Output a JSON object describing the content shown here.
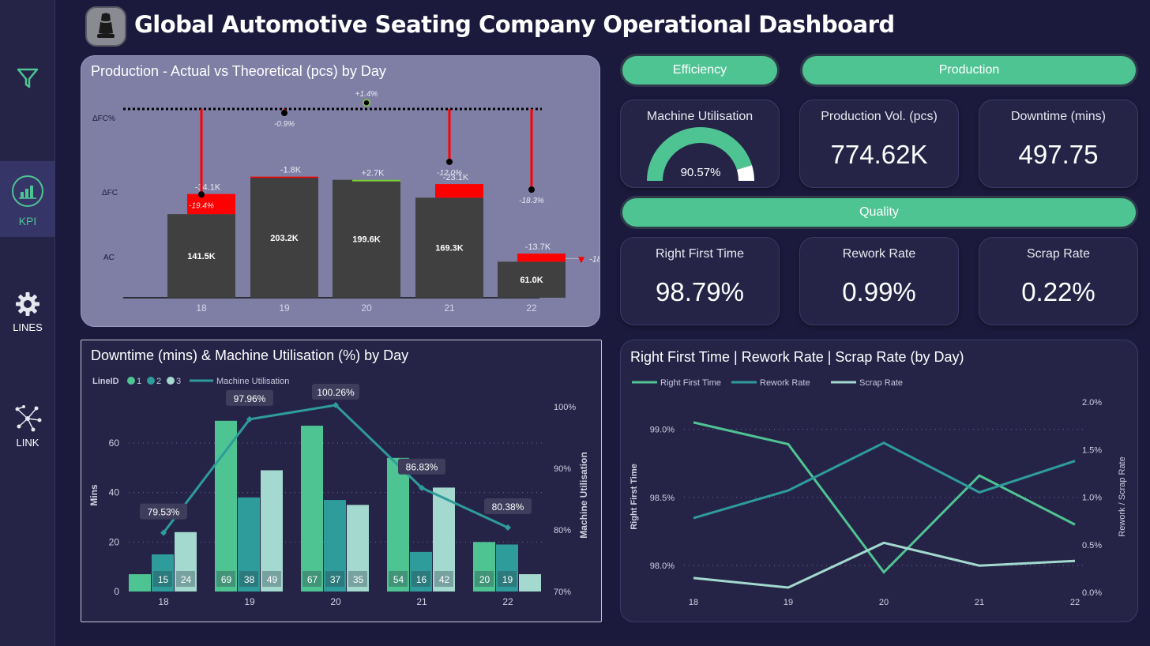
{
  "app": {
    "title": "Global Automotive Seating Company Operational Dashboard"
  },
  "sidebar": {
    "items": [
      {
        "label": "",
        "icon": "filter-icon"
      },
      {
        "label": "KPI",
        "icon": "kpi-chart-icon",
        "active": true
      },
      {
        "label": "LINES",
        "icon": "gear-icon"
      },
      {
        "label": "LINK",
        "icon": "network-link-icon"
      }
    ]
  },
  "colors": {
    "accent": "#4fc493",
    "teal": "#2e9c9a",
    "light_teal": "#a3d9cf",
    "red": "#ff0000",
    "bar_dark": "#404040",
    "panel_lavender": "#7f7fa5",
    "background": "#1c1a3c"
  },
  "sections": {
    "efficiency": "Efficiency",
    "production": "Production",
    "quality": "Quality"
  },
  "kpis": {
    "machine_utilisation": {
      "label": "Machine Utilisation",
      "value": "90.57%",
      "fraction": 0.9057
    },
    "production_vol": {
      "label": "Production Vol. (pcs)",
      "value": "774.62K"
    },
    "downtime": {
      "label": "Downtime (mins)",
      "value": "497.75"
    },
    "right_first_time": {
      "label": "Right First Time",
      "value": "98.79%"
    },
    "rework_rate": {
      "label": "Rework Rate",
      "value": "0.99%"
    },
    "scrap_rate": {
      "label": "Scrap Rate",
      "value": "0.22%"
    }
  },
  "chart_data": [
    {
      "type": "bar",
      "title": "Production - Actual vs Theoretical (pcs) by Day",
      "row_labels": [
        "ΔFC%",
        "ΔFC",
        "AC"
      ],
      "categories": [
        "18",
        "19",
        "20",
        "21",
        "22"
      ],
      "actual": [
        141.5,
        203.2,
        199.6,
        169.3,
        61.0
      ],
      "actual_labels": [
        "141.5K",
        "203.2K",
        "199.6K",
        "169.3K",
        "61.0K"
      ],
      "delta": [
        -34.1,
        -1.8,
        2.7,
        -23.1,
        -13.7
      ],
      "delta_labels": [
        "-34.1K",
        "-1.8K",
        "+2.7K",
        "-23.1K",
        "-13.7K"
      ],
      "delta_pct": [
        -19.4,
        -0.9,
        1.4,
        -12.0,
        -18.3
      ],
      "delta_pct_labels": [
        "-19.4%",
        "-0.9%",
        "+1.4%",
        "-12.0%",
        "-18.3%"
      ],
      "total_delta_label": "-18.3%"
    },
    {
      "type": "bar",
      "title": "Downtime (mins) & Machine Utilisation (%) by Day",
      "legend_title": "LineID",
      "legend": [
        "1",
        "2",
        "3",
        "Machine Utilisation"
      ],
      "categories": [
        "18",
        "19",
        "20",
        "21",
        "22"
      ],
      "series": [
        {
          "name": "1",
          "values": [
            7,
            69,
            67,
            54,
            20
          ]
        },
        {
          "name": "2",
          "values": [
            15,
            38,
            37,
            16,
            19
          ]
        },
        {
          "name": "3",
          "values": [
            24,
            49,
            35,
            42,
            7
          ]
        }
      ],
      "bar_labels": [
        [
          "",
          "15",
          "24"
        ],
        [
          "69",
          "38",
          "49"
        ],
        [
          "67",
          "37",
          "35"
        ],
        [
          "54",
          "16",
          "42"
        ],
        [
          "20",
          "19",
          ""
        ]
      ],
      "line": {
        "name": "Machine Utilisation",
        "values": [
          79.53,
          97.96,
          100.26,
          86.83,
          80.38
        ],
        "labels": [
          "79.53%",
          "97.96%",
          "100.26%",
          "86.83%",
          "80.38%"
        ]
      },
      "ylabel": "Mins",
      "ylabel_right": "Machine Utilisation",
      "y_ticks": [
        "0",
        "20",
        "40",
        "60"
      ],
      "y_right_ticks": [
        "70%",
        "80%",
        "90%",
        "100%"
      ],
      "ylim": [
        0,
        75
      ],
      "ylim_right": [
        70,
        104
      ]
    },
    {
      "type": "line",
      "title": "Right First Time | Rework Rate | Scrap Rate (by Day)",
      "legend": [
        "Right First Time",
        "Rework Rate",
        "Scrap Rate"
      ],
      "categories": [
        "18",
        "19",
        "20",
        "21",
        "22"
      ],
      "series": [
        {
          "name": "Right First Time",
          "axis": "left",
          "values": [
            99.05,
            98.89,
            97.95,
            98.66,
            98.3
          ]
        },
        {
          "name": "Rework Rate",
          "axis": "right",
          "values": [
            0.78,
            1.07,
            1.57,
            1.05,
            1.38
          ]
        },
        {
          "name": "Scrap Rate",
          "axis": "right",
          "values": [
            0.15,
            0.05,
            0.52,
            0.28,
            0.33
          ]
        }
      ],
      "ylabel": "Right First Time",
      "ylabel_right": "Rework / Scrap Rate",
      "y_ticks": [
        "98.0%",
        "98.5%",
        "99.0%"
      ],
      "y_right_ticks": [
        "0.0%",
        "0.5%",
        "1.0%",
        "1.5%",
        "2.0%"
      ],
      "ylim": [
        97.85,
        99.2
      ],
      "ylim_right": [
        0,
        2.0
      ]
    }
  ]
}
